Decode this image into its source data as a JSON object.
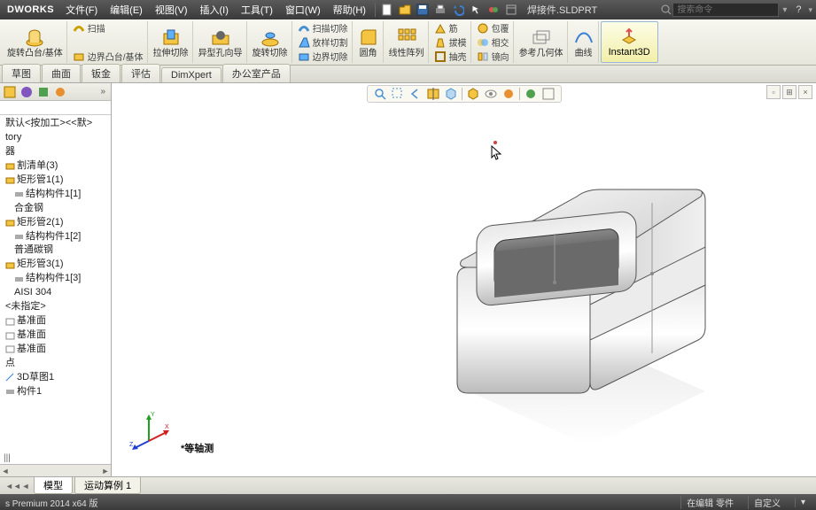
{
  "app": {
    "logo": "DWORKS",
    "docname": "焊接件.SLDPRT",
    "search_placeholder": "搜索命令",
    "help": "?"
  },
  "menu": {
    "file": "文件(F)",
    "edit": "编辑(E)",
    "view": "视图(V)",
    "insert": "插入(I)",
    "tools": "工具(T)",
    "window": "窗口(W)",
    "help": "帮助(H)"
  },
  "ribbon": {
    "g1a": "扫描",
    "g1b": "旋转凸台/基体",
    "g1c": "边界凸台/基体",
    "g2a": "拉伸切除",
    "g2b": "异型孔向导",
    "g2c": "旋转切除",
    "g2d": "扫描切除",
    "g2e": "放样切割",
    "g2f": "边界切除",
    "g3a": "圆角",
    "g3b": "线性阵列",
    "g4a": "筋",
    "g4b": "拔模",
    "g4c": "抽壳",
    "g5a": "包覆",
    "g5b": "相交",
    "g5c": "镜向",
    "g6": "参考几何体",
    "g7": "曲线",
    "g8": "Instant3D"
  },
  "doctabs": {
    "t1": "草图",
    "t2": "曲面",
    "t3": "钣金",
    "t4": "评估",
    "t5": "DimXpert",
    "t6": "办公室产品"
  },
  "tree": {
    "r0": "默认<按加工><<默>",
    "r1": "tory",
    "r2": "器",
    "r3": "割清单(3)",
    "r4": "矩形管1(1)",
    "r5": "结构构件1[1]",
    "r6": "合金钢",
    "r7": "矩形管2(1)",
    "r8": "结构构件1[2]",
    "r9": "普通碳钢",
    "r10": "矩形管3(1)",
    "r11": "结构构件1[3]",
    "r12": "AISI 304",
    "r13": "<未指定>",
    "r14": "基准面",
    "r15": "基准面",
    "r16": "基准面",
    "r17": "点",
    "r18": "3D草图1",
    "r19": "构件1"
  },
  "viewlabel": "等轴测",
  "bottomtabs": {
    "arrow_l": "◄◄",
    "arrow_l2": "◄",
    "t1": "模型",
    "t2": "运动算例 1"
  },
  "status": {
    "left": "s Premium 2014 x64 版",
    "r1": "在编辑 零件",
    "r2": "自定义"
  }
}
